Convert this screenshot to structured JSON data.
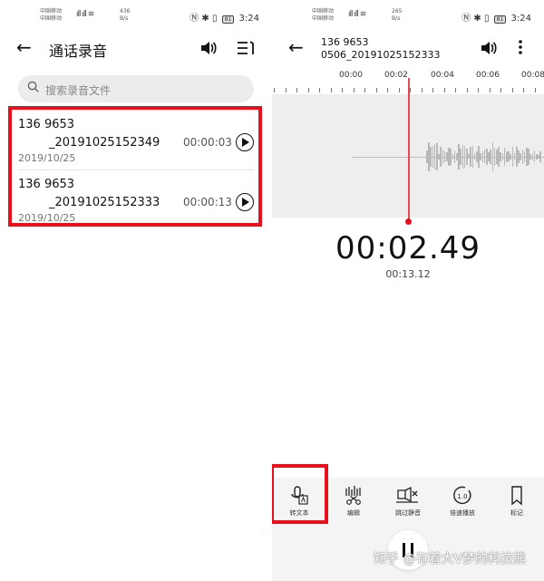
{
  "left": {
    "status": {
      "carrier": "中国移动",
      "speed_value": "436",
      "speed_unit": "B/s",
      "battery": "81",
      "time": "3:24"
    },
    "title": "通话录音",
    "search_placeholder": "搜索录音文件",
    "recordings": [
      {
        "number": "136 9653",
        "filename": "_20191025152349",
        "duration": "00:00:03",
        "date": "2019/10/25"
      },
      {
        "number": "136 9653",
        "filename": "_20191025152333",
        "duration": "00:00:13",
        "date": "2019/10/25"
      }
    ]
  },
  "right": {
    "status": {
      "carrier": "中国移动",
      "speed_value": "265",
      "speed_unit": "B/s",
      "battery": "81",
      "time": "3:24"
    },
    "title_number": "136 9653",
    "title_filename": "0506_20191025152333",
    "timeline_labels": [
      "00:00",
      "00:02",
      "00:04",
      "00:06",
      "00:08"
    ],
    "current_time": "00:02.49",
    "total_time": "00:13.12",
    "tools": [
      {
        "label": "转文本",
        "icon": "speech-to-text-icon"
      },
      {
        "label": "编辑",
        "icon": "edit-waveform-icon"
      },
      {
        "label": "跳过静音",
        "icon": "skip-silence-icon"
      },
      {
        "label": "倍速播放",
        "icon": "speed-playback-icon"
      },
      {
        "label": "标记",
        "icon": "bookmark-icon"
      }
    ],
    "speed_badge": "1.0"
  },
  "watermark": "知乎 @有着大V梦的科技熊",
  "colors": {
    "highlight": "#e8111b",
    "playhead": "#e44b4b",
    "waveform": "#b8b8b8"
  }
}
